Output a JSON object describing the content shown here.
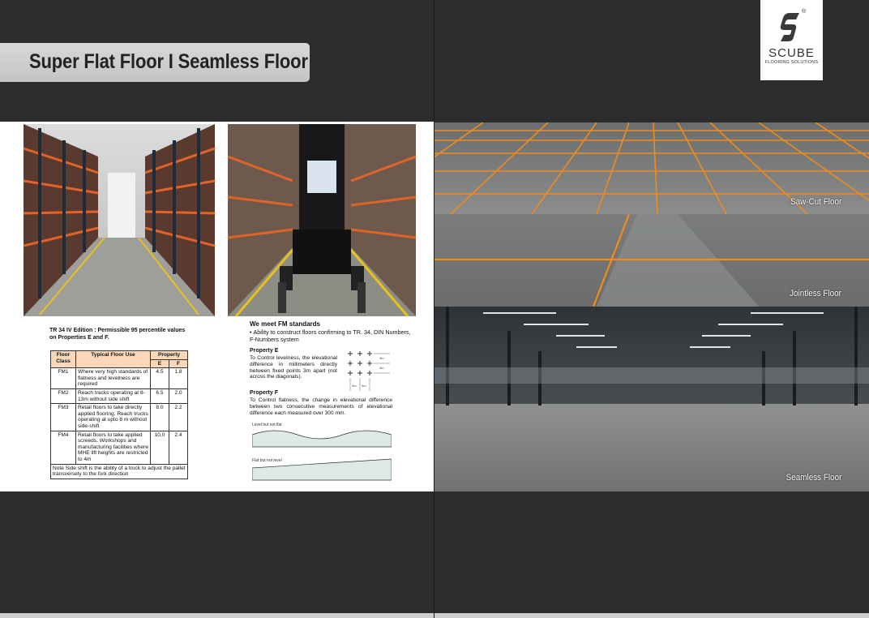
{
  "header": {
    "title": "Super Flat Floor I Seamless Floor"
  },
  "logo": {
    "name": "SCUBE",
    "tagline": "FLOORING SOLUTIONS",
    "registered": "®"
  },
  "captions": {
    "saw_cut": "Saw-Cut Floor",
    "jointless": "Jointless Floor",
    "seamless": "Seamless Floor"
  },
  "tr34": {
    "heading": "TR 34 IV Edition : Permissible 95 percentile values on Properties E and F.",
    "columns": {
      "floor_class": "Floor Class",
      "typical_use": "Typical Floor Use",
      "property": "Property",
      "e": "E",
      "f": "F"
    },
    "rows": [
      {
        "cls": "FM1",
        "use": "Where very high standards of flatness and levelness are required",
        "e": "4.5",
        "f": "1.8"
      },
      {
        "cls": "FM2",
        "use": "Reach tracks operating at 8-13m without side shift",
        "e": "6.5",
        "f": "2.0"
      },
      {
        "cls": "FM3",
        "use": "Retail floors to take directly applied flooring. Reach trucks operating at upto 8 m without side-shift",
        "e": "8.0",
        "f": "2.2"
      },
      {
        "cls": "FM4",
        "use": "Retail floors to take applied screeds. Workshops and manufacturing facilities where MHE lift heights are restricted to 4m",
        "e": "10.0",
        "f": "2.4"
      }
    ],
    "note": "Note Side shift is the ability of a truck to adjust the pallet transversely to the fork direction"
  },
  "fm": {
    "heading": "We meet FM standards",
    "bullet": "Ability to construct floors confirming to TR. 34, DIN Numbers, F-Numbers system",
    "prop_e_title": "Property E",
    "prop_e_text": "To Control leveIness, the elevational difference in millimeters directly between fixed points 3m apart (not across the diagonals).",
    "grid_labels": {
      "v1": "3m",
      "v2": "3m",
      "h1": "3m",
      "h2": "3m"
    },
    "prop_f_title": "Property F",
    "prop_f_text": "To Control flatness, the change in elevational difference between two consecutive measurements of elevational difference each measured over 300 mm.",
    "level_not_flat": "Level but not flat",
    "flat_not_level": "Flat but not level"
  },
  "colors": {
    "background": "#2d2c2d",
    "title_bar": "#cccccc",
    "table_header": "#fbd7b8",
    "joint_orange": "#f28a1e"
  }
}
